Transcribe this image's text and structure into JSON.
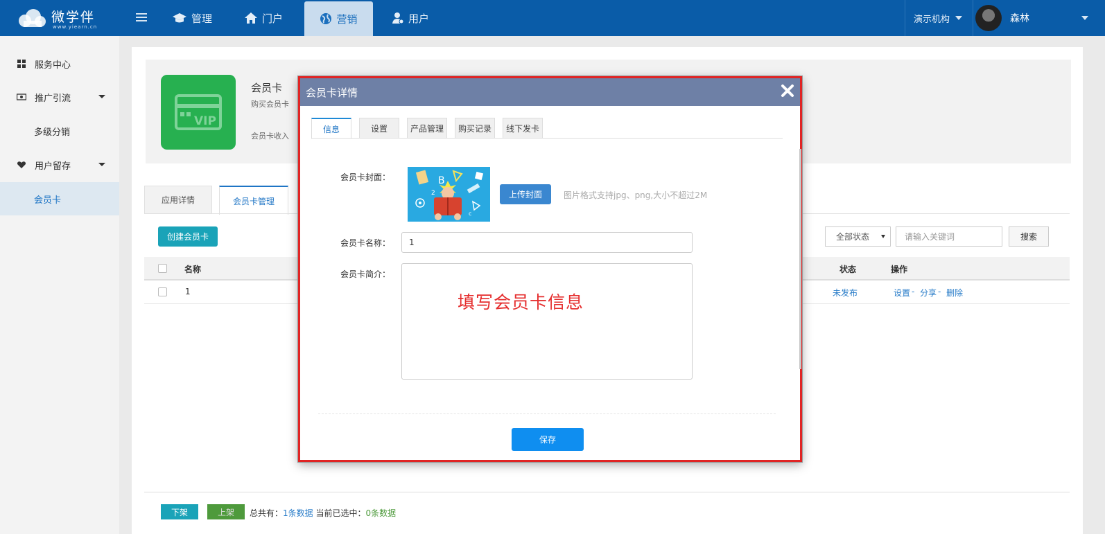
{
  "topbar": {
    "brand": "微学伴",
    "site": "www.yiearn.cn",
    "nav": [
      {
        "label": "管理",
        "icon": "graduation-cap-icon"
      },
      {
        "label": "门户",
        "icon": "home-icon"
      },
      {
        "label": "营销",
        "icon": "globe-icon",
        "active": true
      },
      {
        "label": "用户",
        "icon": "user-icon"
      }
    ],
    "org": "演示机构",
    "username": "森林",
    "bg_color": "#0a5ca8"
  },
  "sidebar": {
    "items": [
      {
        "label": "服务中心",
        "icon": "grid-icon"
      },
      {
        "label": "推广引流",
        "icon": "money-icon",
        "expandable": true
      },
      {
        "label": "多级分销",
        "sub": true
      },
      {
        "label": "用户留存",
        "icon": "heart-icon",
        "expandable": true
      },
      {
        "label": "会员卡",
        "sub": true,
        "active": true
      }
    ]
  },
  "app": {
    "title": "会员卡",
    "desc": "购买会员卡",
    "income": "会员卡收入",
    "vip_text": "VIP",
    "tabs": [
      "应用详情",
      "会员卡管理"
    ]
  },
  "toolbar": {
    "create_label": "创建会员卡",
    "status_label": "全部状态",
    "keyword_placeholder": "请输入关键词",
    "search_label": "搜索"
  },
  "table": {
    "headers": {
      "name": "名称",
      "status": "状态",
      "actions": "操作"
    },
    "rows": [
      {
        "name": "1",
        "status": "未发布",
        "actions": [
          "设置",
          "分享",
          "删除"
        ]
      }
    ]
  },
  "footer": {
    "off_label": "下架",
    "on_label": "上架",
    "total_prefix": "总共有：",
    "total_value": "1条数据",
    "selected_prefix": "当前已选中：",
    "selected_value": "0条数据"
  },
  "modal": {
    "title": "会员卡详情",
    "tabs": [
      "信息",
      "设置",
      "产品管理",
      "购买记录",
      "线下发卡"
    ],
    "cover_label": "会员卡封面：",
    "upload_label": "上传封面",
    "upload_hint": "图片格式支持jpg、png,大小不超过2M",
    "name_label": "会员卡名称：",
    "name_value": "1",
    "intro_label": "会员卡简介：",
    "intro_note": "填写会员卡信息",
    "save_label": "保存",
    "highlight_color": "#e02424"
  }
}
